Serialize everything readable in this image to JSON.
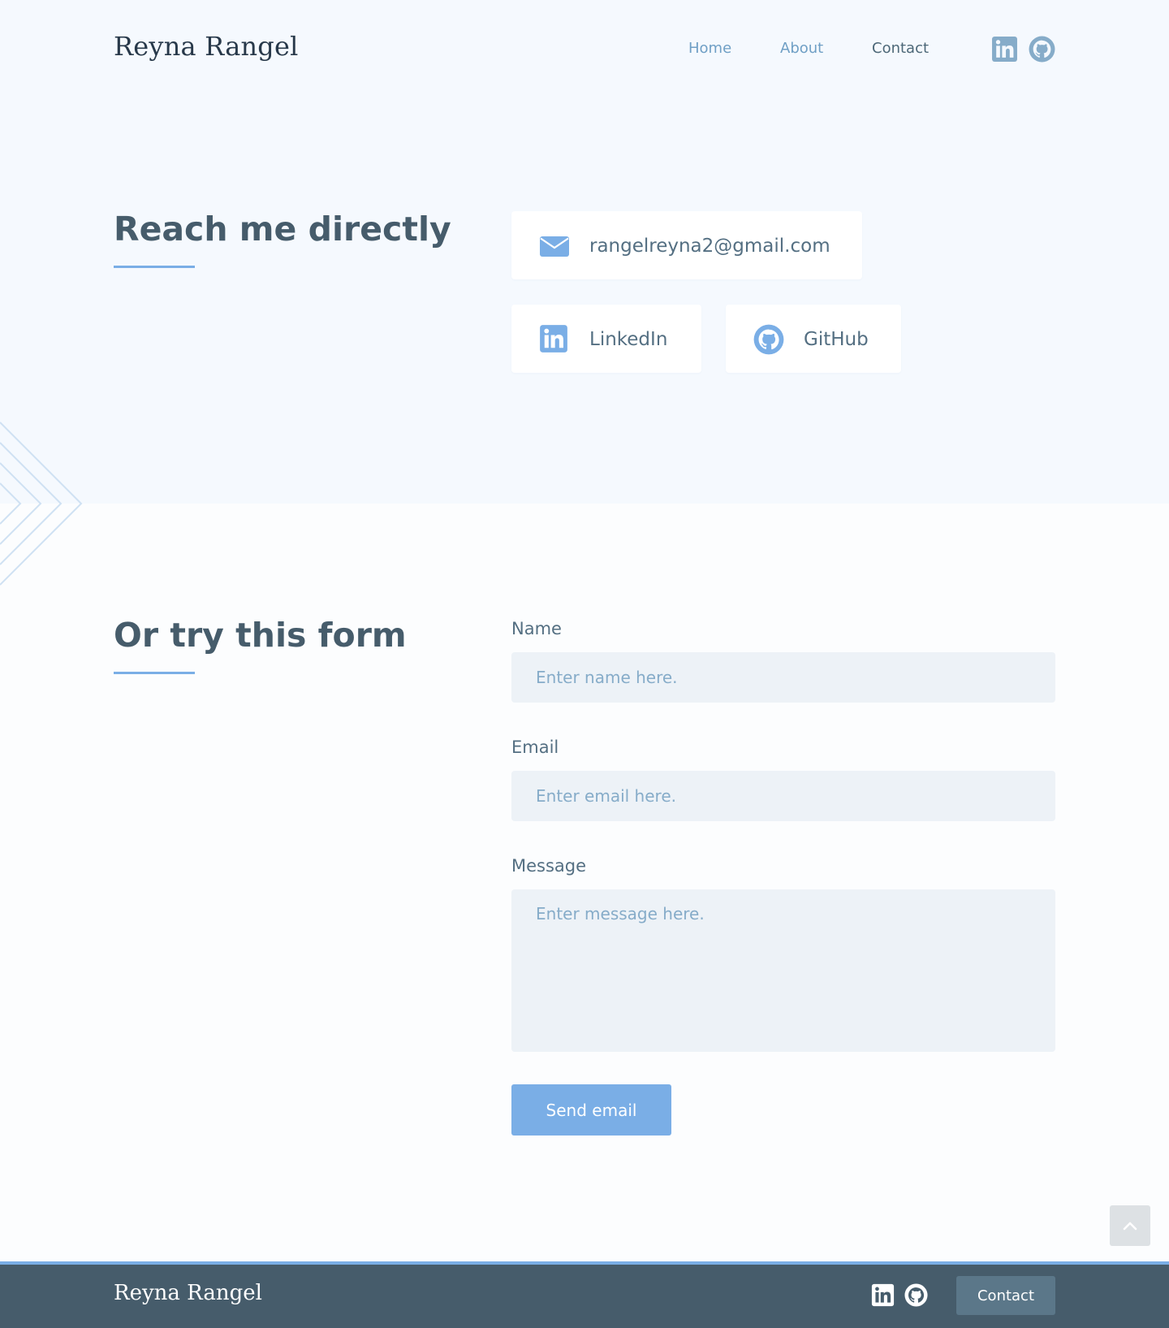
{
  "header": {
    "brand": "Reyna Rangel",
    "nav": [
      {
        "label": "Home"
      },
      {
        "label": "About"
      },
      {
        "label": "Contact",
        "active": true
      }
    ],
    "icons": [
      "linkedin-icon",
      "github-icon"
    ]
  },
  "direct": {
    "title": "Reach me directly",
    "email": {
      "icon": "envelope-icon",
      "label": "rangelreyna2@gmail.com"
    },
    "linkedin": {
      "icon": "linkedin-icon",
      "label": "LinkedIn"
    },
    "github": {
      "icon": "github-icon",
      "label": "GitHub"
    }
  },
  "form": {
    "title": "Or try this form",
    "name": {
      "label": "Name",
      "placeholder": "Enter name here."
    },
    "email": {
      "label": "Email",
      "placeholder": "Enter email here."
    },
    "message": {
      "label": "Message",
      "placeholder": "Enter message here."
    },
    "submit_label": "Send email"
  },
  "scroll_top": {
    "icon": "chevron-up-icon"
  },
  "footer": {
    "brand": "Reyna Rangel",
    "icons": [
      "linkedin-icon",
      "github-icon"
    ],
    "contact_label": "Contact"
  },
  "colors": {
    "accent": "#7aaee6",
    "text_dark": "#465c6b",
    "top_bg": "#f5f9fe",
    "footer_bg": "#465c6b"
  }
}
